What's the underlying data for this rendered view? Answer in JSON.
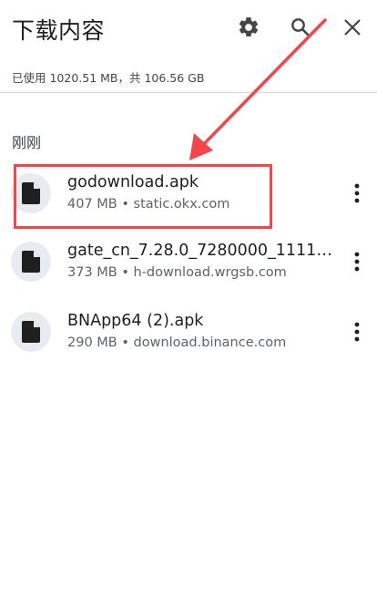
{
  "header": {
    "title": "下载内容",
    "settings_icon": "gear-icon",
    "search_icon": "search-icon",
    "close_icon": "close-icon"
  },
  "storage": {
    "text": "已使用 1020.51 MB，共 106.56 GB"
  },
  "section": {
    "label": "刚刚"
  },
  "downloads": [
    {
      "name": "godownload.apk",
      "meta": "407 MB • static.okx.com",
      "icon": "file-icon"
    },
    {
      "name": "gate_cn_7.28.0_7280000_11111...",
      "meta": "373 MB • h-download.wrgsb.com",
      "icon": "file-icon"
    },
    {
      "name": "BNApp64 (2).apk",
      "meta": "290 MB • download.binance.com",
      "icon": "file-icon"
    }
  ],
  "annotation": {
    "color": "#f0464c"
  }
}
